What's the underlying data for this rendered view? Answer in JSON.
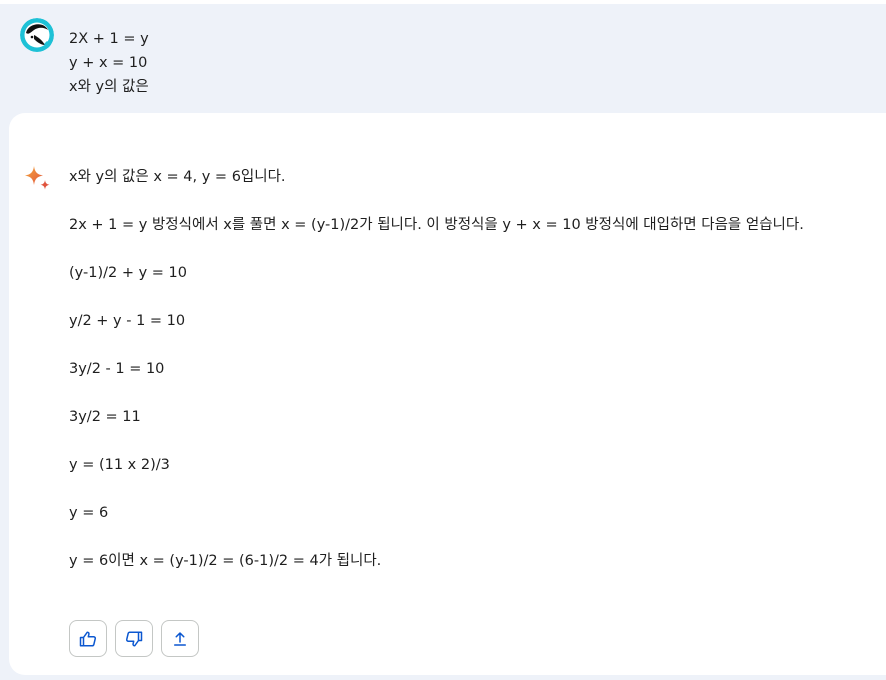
{
  "user_prompt": {
    "lines": [
      "2X + 1 = y",
      "y + x = 10",
      "x와 y의 값은"
    ]
  },
  "response": {
    "paragraphs": [
      "x와 y의 값은 x = 4, y = 6입니다.",
      "2x + 1 = y 방정식에서 x를 풀면 x = (y-1)/2가 됩니다. 이 방정식을 y + x = 10 방정식에 대입하면 다음을 얻습니다.",
      "(y-1)/2 + y = 10",
      "y/2 + y - 1 = 10",
      "3y/2 - 1 = 10",
      "3y/2 = 11",
      "y = (11 x 2)/3",
      "y = 6",
      "y = 6이면 x = (y-1)/2 = (6-1)/2 = 4가 됩니다."
    ]
  },
  "actions": {
    "icons": [
      "thumbs-up-icon",
      "thumbs-down-icon",
      "share-icon"
    ]
  },
  "colors": {
    "page_background": "#eef2f9",
    "card_background": "#ffffff",
    "icon_blue": "#0b57d0",
    "button_border": "#c4c7c5",
    "text": "#1f1f1f"
  }
}
